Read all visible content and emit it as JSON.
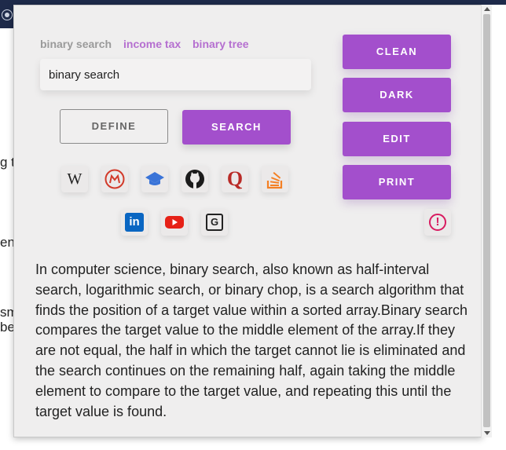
{
  "background_page": {
    "fragments": [
      "g t",
      "enc",
      "sm",
      " be"
    ]
  },
  "recent_searches": [
    {
      "label": "binary search",
      "active": false
    },
    {
      "label": "income tax",
      "active": true
    },
    {
      "label": "binary tree",
      "active": true
    }
  ],
  "search": {
    "value": "binary search",
    "placeholder": ""
  },
  "buttons": {
    "define": "DEFINE",
    "search": "SEARCH",
    "clean": "CLEAN",
    "dark": "DARK",
    "edit": "EDIT",
    "print": "PRINT"
  },
  "sources": [
    {
      "icon": "wikipedia-icon",
      "glyph": "W"
    },
    {
      "icon": "merriam-webster-icon"
    },
    {
      "icon": "scholar-icon"
    },
    {
      "icon": "github-icon"
    },
    {
      "icon": "quora-icon",
      "glyph": "Q"
    },
    {
      "icon": "stackoverflow-icon"
    },
    {
      "icon": "linkedin-icon",
      "glyph": "in"
    },
    {
      "icon": "youtube-icon"
    },
    {
      "icon": "google-translate-icon",
      "glyph": "G"
    },
    {
      "icon": "report-issue-icon",
      "glyph": "!"
    }
  ],
  "definition": "In computer science, binary search, also known as half-interval search, logarithmic search, or binary chop, is a search algorithm that finds the position of a target value within a sorted array.Binary search compares the target value to the middle element of the array.If they are not equal, the half in which the target cannot lie is eliminated and the search continues on the remaining half, again taking the middle element to compare to the target value, and repeating this until the target value is found.",
  "colors": {
    "accent": "#a34fcc",
    "link": "#b56fd0",
    "panel": "#efeeee"
  }
}
